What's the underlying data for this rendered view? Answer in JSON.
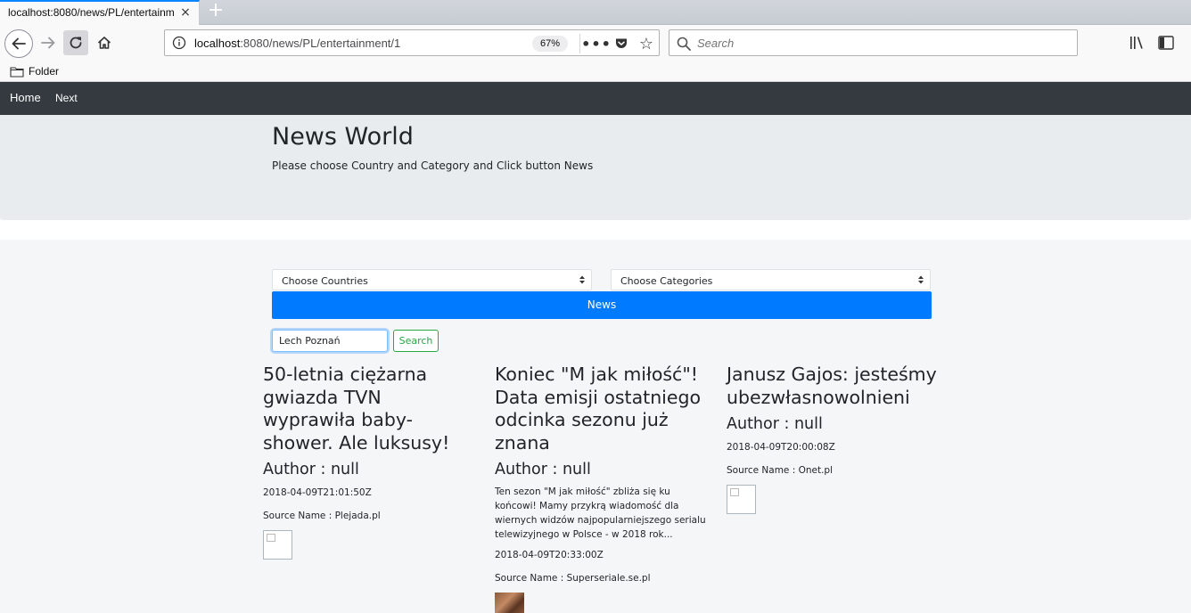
{
  "browser": {
    "tab_title": "localhost:8080/news/PL/entertainment/1",
    "tab_close": "×",
    "new_tab": "+",
    "url_host": "localhost",
    "url_path": ":8080/news/PL/entertainment/1",
    "zoom": "67%",
    "search_placeholder": "Search",
    "bookmark_folder": "Folder"
  },
  "site": {
    "nav": {
      "home": "Home",
      "next": "Next"
    },
    "jumbotron": {
      "title": "News World",
      "lead": "Please choose Country and Category and Click button News"
    },
    "form": {
      "countries_select": "Choose Countries",
      "categories_select": "Choose Categories",
      "news_button": "News",
      "search_value": "Lech Poznań",
      "search_button": "Search"
    },
    "articles": [
      {
        "title": "50-letnia ciężarna gwiazda TVN wyprawiła baby-shower. Ale luksusy!",
        "author": "Author : null",
        "description": "",
        "date": "2018-04-09T21:01:50Z",
        "source": "Source Name : Plejada.pl"
      },
      {
        "title": "Koniec \"M jak miłość\"! Data emisji ostatniego odcinka sezonu już znana",
        "author": "Author : null",
        "description": "Ten sezon \"M jak miłość\" zbliża się ku końcowi! Mamy przykrą wiadomość dla wiernych widzów najpopularniejszego serialu telewizyjnego w Polsce - w 2018 rok...",
        "date": "2018-04-09T20:33:00Z",
        "source": "Source Name : Superseriale.se.pl"
      },
      {
        "title": "Janusz Gajos: jesteśmy ubezwłasnowolnieni",
        "author": "Author : null",
        "description": "",
        "date": "2018-04-09T20:00:08Z",
        "source": "Source Name : Onet.pl"
      }
    ]
  }
}
